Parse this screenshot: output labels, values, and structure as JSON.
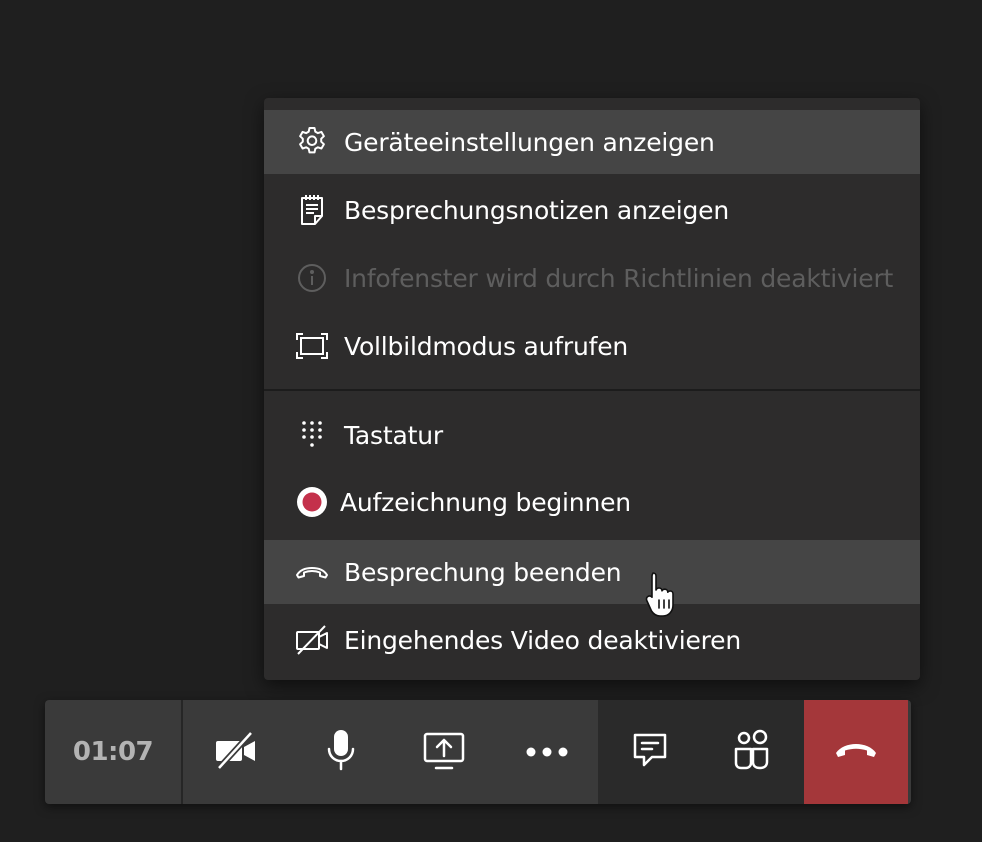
{
  "menu": {
    "items": [
      {
        "label": "Geräteeinstellungen anzeigen",
        "icon": "gear-icon",
        "state": "hover"
      },
      {
        "label": "Besprechungsnotizen anzeigen",
        "icon": "notes-icon",
        "state": "normal"
      },
      {
        "label": "Infofenster wird durch Richtlinien deaktiviert",
        "icon": "info-icon",
        "state": "disabled"
      },
      {
        "label": "Vollbildmodus aufrufen",
        "icon": "fullscreen-icon",
        "state": "normal"
      },
      {
        "label": "Tastatur",
        "icon": "dialpad-icon",
        "state": "normal"
      },
      {
        "label": "Aufzeichnung beginnen",
        "icon": "record-icon",
        "state": "normal"
      },
      {
        "label": "Besprechung beenden",
        "icon": "end-meeting-icon",
        "state": "hover"
      },
      {
        "label": "Eingehendes Video deaktivieren",
        "icon": "video-off-icon",
        "state": "normal"
      }
    ]
  },
  "toolbar": {
    "timer": "01:07",
    "buttons": [
      {
        "name": "camera-toggle-button",
        "icon": "camera-off-icon"
      },
      {
        "name": "microphone-button",
        "icon": "microphone-icon"
      },
      {
        "name": "share-screen-button",
        "icon": "share-screen-icon"
      },
      {
        "name": "more-actions-button",
        "icon": "more-icon"
      },
      {
        "name": "chat-button",
        "icon": "chat-icon"
      },
      {
        "name": "participants-button",
        "icon": "people-icon"
      },
      {
        "name": "hang-up-button",
        "icon": "hang-up-icon"
      }
    ]
  },
  "colors": {
    "background": "#1f1f1f",
    "menu_bg": "#2d2c2c",
    "menu_hover": "#454545",
    "disabled_text": "#5e5e5e",
    "record_red": "#c4314b",
    "hang_up": "#a4373a"
  }
}
